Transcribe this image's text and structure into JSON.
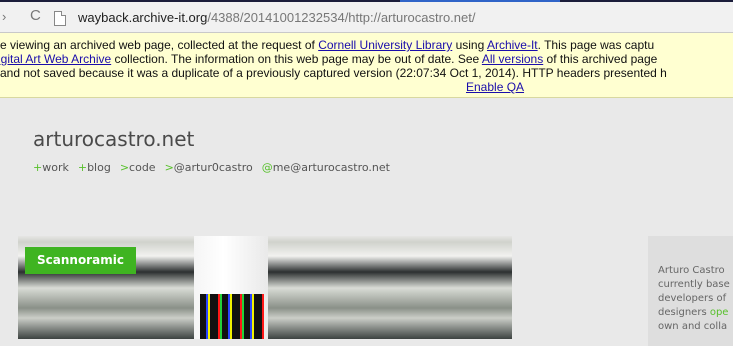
{
  "browser": {
    "url_host": "wayback.archive-it.org",
    "url_path": "/4388/20141001232534/http://arturocastro.net/"
  },
  "banner": {
    "l1_a": "re viewing an archived web page, collected at the request of ",
    "l1_link1": "Cornell University Library",
    "l1_b": " using ",
    "l1_link2": "Archive-It",
    "l1_c": ". This page was captu",
    "l2_link": "igital Art Web Archive",
    "l2_a": " collection. The information on this web page may be out of date. See ",
    "l2_link2": "All versions",
    "l2_b": " of this archived page",
    "l3": "and not saved because it was a duplicate of a previously captured version (22:07:34 Oct 1, 2014). HTTP headers presented h",
    "l4_link": "Enable QA"
  },
  "site": {
    "title": "arturocastro.net",
    "nav": [
      {
        "prefix": "+",
        "label": "work"
      },
      {
        "prefix": "+",
        "label": "blog"
      },
      {
        "prefix": ">",
        "label": "code"
      },
      {
        "prefix": ">",
        "label": "@artur0castro"
      },
      {
        "prefix": "@",
        "label": "me@arturocastro.net"
      }
    ]
  },
  "hero": {
    "tag": "Scannoramic"
  },
  "sidebar": {
    "line1": "Arturo Castro",
    "line2": "currently base",
    "line3": "developers of",
    "line4a": "designers ",
    "line4b": "ope",
    "line5": "own and colla"
  }
}
